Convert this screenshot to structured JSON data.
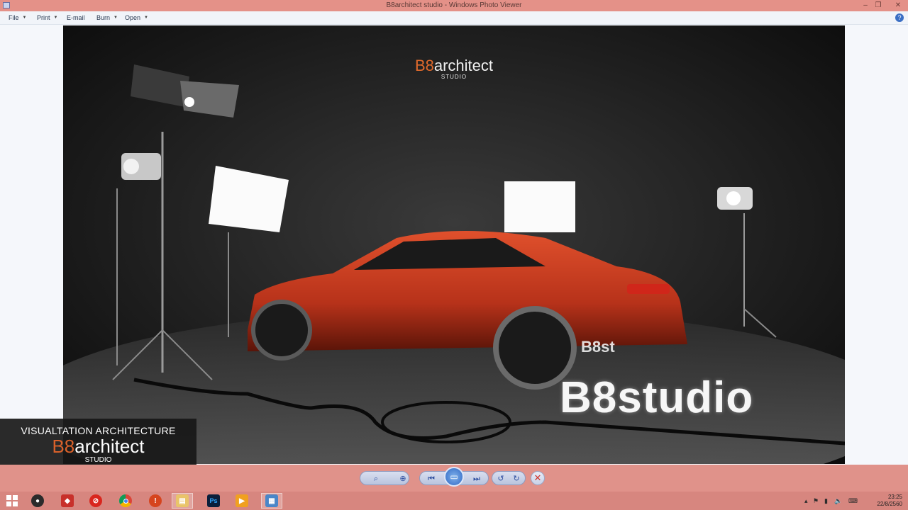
{
  "window": {
    "title": "B8architect studio - Windows Photo Viewer",
    "minimize": "–",
    "restore": "❐",
    "close": "✕"
  },
  "menu": {
    "file": "File",
    "print": "Print",
    "email": "E-mail",
    "burn": "Burn",
    "open": "Open",
    "help": "?"
  },
  "photo": {
    "logo_b8": "B8",
    "logo_arch": "architect",
    "logo_sub": "STUDIO",
    "brand_text": "B8studio",
    "door_text": "B8st"
  },
  "overlay": {
    "line1": "VISUALTATION ARCHITECTURE",
    "b8": "B8",
    "arch": "architect",
    "line3": "STUDIO"
  },
  "controls": {
    "zoom": "⌕",
    "fit": "⊕",
    "prev": "⏮",
    "slideshow": "▭",
    "next": "⏭",
    "rotate_ccw": "↺",
    "rotate_cw": "↻",
    "delete": "✕"
  },
  "taskbar": {
    "clock_time": "23:25",
    "clock_date": "22/8/2560",
    "apps": [
      "start-icon",
      "obs-icon",
      "app-icon",
      "no-entry-icon",
      "chrome-icon",
      "app2-icon",
      "file-explorer-icon",
      "photoshop-icon",
      "media-player-icon",
      "photo-viewer-icon"
    ]
  },
  "colors": {
    "accent": "#e06a2c",
    "titlebar": "#e49188",
    "taskbar": "#d7867f"
  }
}
